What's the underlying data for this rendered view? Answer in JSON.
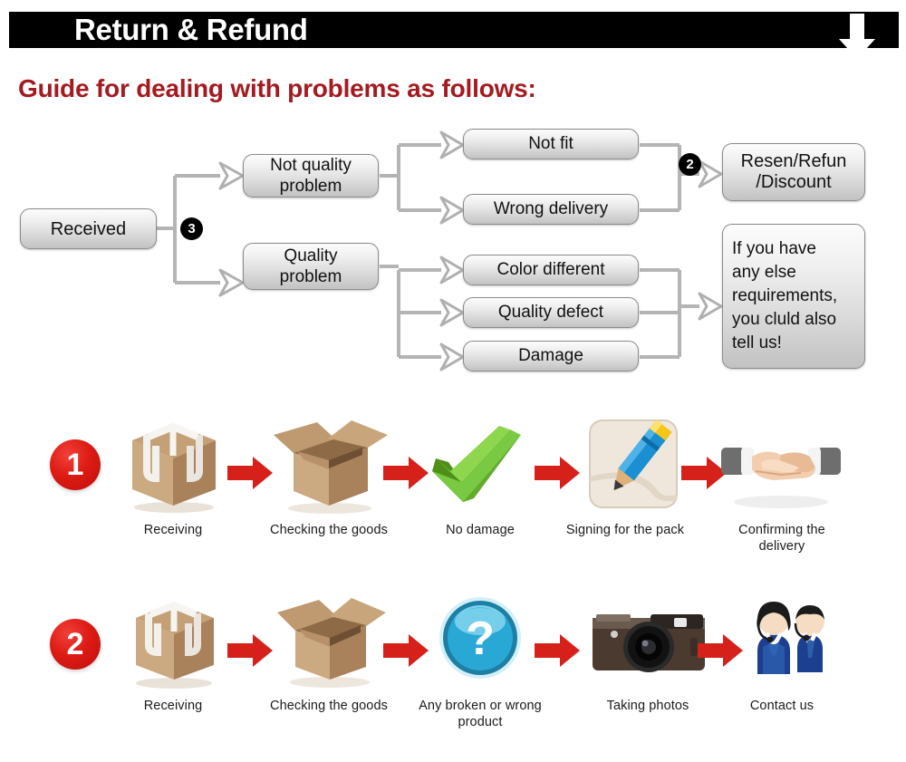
{
  "header": {
    "title": "Return & Refund",
    "down_arrow_icon": "arrow-down-icon",
    "bar_color": "#000000",
    "title_color": "#ffffff"
  },
  "subtitle": {
    "text": "Guide for dealing with problems as follows:",
    "color": "#A31B20"
  },
  "flowchart": {
    "start": {
      "label": "Received"
    },
    "badges": [
      {
        "id": "badge-3",
        "label": "3"
      },
      {
        "id": "badge-2",
        "label": "2"
      }
    ],
    "branches": [
      {
        "label": "Not quality\nproblem",
        "line1": "Not quality",
        "line2": "problem"
      },
      {
        "label": "Quality\nproblem",
        "line1": "Quality",
        "line2": "problem"
      }
    ],
    "not_quality_reasons": [
      {
        "label": "Not fit"
      },
      {
        "label": "Wrong delivery"
      }
    ],
    "quality_reasons": [
      {
        "label": "Color different"
      },
      {
        "label": "Quality defect"
      },
      {
        "label": "Damage"
      }
    ],
    "outcomes": [
      {
        "line1": "Resen/Refun",
        "line2": "/Discount"
      },
      {
        "lines": [
          "If you have",
          "any else",
          "requirements,",
          "you cluld also",
          "tell us!"
        ]
      }
    ],
    "box_fill_top": "#fcfcfc",
    "box_fill_bottom": "#c2c2c2",
    "box_border": "#8b8b8b",
    "connector_color": "#b9b9b9"
  },
  "steps": {
    "arrow_color": "#D6211A",
    "rows": [
      {
        "number": "1",
        "items": [
          {
            "icon": "closed-box-icon",
            "caption": "Receiving"
          },
          {
            "icon": "open-box-icon",
            "caption": "Checking the goods"
          },
          {
            "icon": "green-check-icon",
            "caption": "No damage"
          },
          {
            "icon": "pencil-signing-icon",
            "caption": "Signing for the pack"
          },
          {
            "icon": "handshake-icon",
            "caption": "Confirming the delivery"
          }
        ]
      },
      {
        "number": "2",
        "items": [
          {
            "icon": "closed-box-icon",
            "caption": "Receiving"
          },
          {
            "icon": "open-box-icon",
            "caption": "Checking the goods"
          },
          {
            "icon": "question-mark-icon",
            "caption": "Any broken or wrong product"
          },
          {
            "icon": "camera-icon",
            "caption": "Taking photos"
          },
          {
            "icon": "support-agents-icon",
            "caption": "Contact us"
          }
        ]
      }
    ]
  }
}
